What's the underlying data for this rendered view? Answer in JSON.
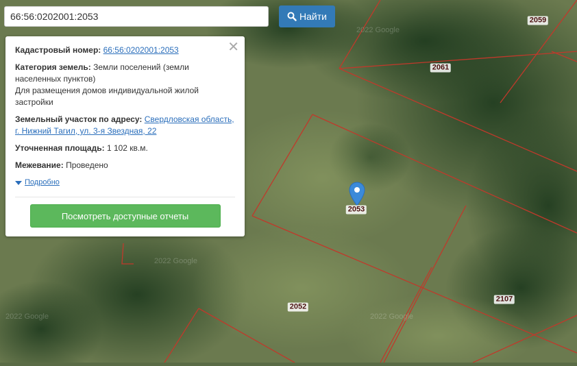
{
  "search": {
    "value": "66:56:0202001:2053",
    "button_label": "Найти",
    "button_icon": "search-icon"
  },
  "info": {
    "cadastral_label": "Кадастровый номер:",
    "cadastral_value": "66:56:0202001:2053",
    "category_label": "Категория земель:",
    "category_value": "Земли поселений (земли населенных пунктов)",
    "usage_value": "Для размещения домов индивидуальной жилой застройки",
    "address_label": "Земельный участок по адресу:",
    "address_value": "Свердловская область, г. Нижний Тагил, ул. 3-я Звездная, 22",
    "area_label": "Уточненная площадь:",
    "area_value": "1 102 кв.м.",
    "survey_label": "Межевание:",
    "survey_value": "Проведено",
    "details_link": "Подробно",
    "reports_button": "Посмотреть доступные отчеты",
    "close_icon": "close-icon"
  },
  "map": {
    "parcel_labels": [
      "2059",
      "2061",
      "2053",
      "2052",
      "2107"
    ],
    "watermarks": [
      "2022 Google",
      "2022 Google",
      "2022 Google",
      "2022 Google"
    ],
    "boundary_color": "#c0392b",
    "marker_color": "#3b8ad9"
  }
}
